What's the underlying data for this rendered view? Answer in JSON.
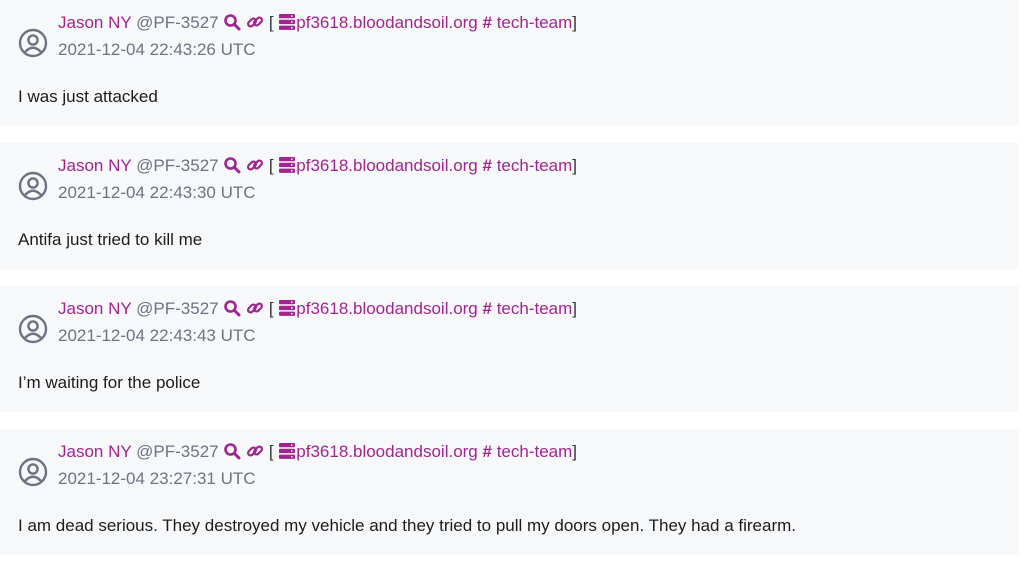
{
  "messages": [
    {
      "author": "Jason NY",
      "handle": "@PF-3527",
      "server": "pf3618.bloodandsoil.org",
      "channel": "tech-team",
      "timestamp": "2021-12-04 22:43:26 UTC",
      "text": "I was just attacked"
    },
    {
      "author": "Jason NY",
      "handle": "@PF-3527",
      "server": "pf3618.bloodandsoil.org",
      "channel": "tech-team",
      "timestamp": "2021-12-04 22:43:30 UTC",
      "text": "Antifa just tried to kill me"
    },
    {
      "author": "Jason NY",
      "handle": "@PF-3527",
      "server": "pf3618.bloodandsoil.org",
      "channel": "tech-team",
      "timestamp": "2021-12-04 22:43:43 UTC",
      "text": "I’m waiting for the police"
    },
    {
      "author": "Jason NY",
      "handle": "@PF-3527",
      "server": "pf3618.bloodandsoil.org",
      "channel": "tech-team",
      "timestamp": "2021-12-04 23:27:31 UTC",
      "text": "I am dead serious. They destroyed my vehicle and they tried to pull my doors open. They had a firearm."
    }
  ],
  "punctuation": {
    "open_bracket": "[",
    "close_bracket": "]",
    "hash": "#"
  },
  "icons": {
    "avatar": "user-circle-icon",
    "search": "search-icon",
    "link": "link-icon",
    "server": "server-icon"
  },
  "colors": {
    "accent": "#a1258f",
    "muted": "#6d7380",
    "card_background": "#f7f8fa",
    "text": "#1c1c1c"
  }
}
